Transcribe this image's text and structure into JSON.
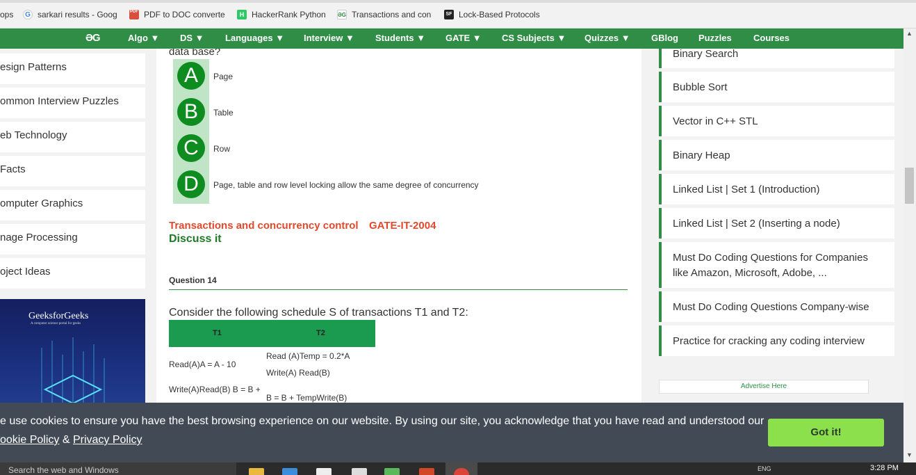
{
  "bookmarks": [
    {
      "label": "ops",
      "icon": "apps-icon",
      "color": ""
    },
    {
      "label": "sarkari results - Goog",
      "icon": "google-icon",
      "color": "#4285f4"
    },
    {
      "label": "PDF to DOC converte",
      "icon": "pdf-icon",
      "color": "#d94f3d"
    },
    {
      "label": "HackerRank Python",
      "icon": "hackerrank-icon",
      "color": "#2ec866"
    },
    {
      "label": "Transactions and con",
      "icon": "gfg-icon",
      "color": "#2f8d46"
    },
    {
      "label": "Lock-Based Protocols",
      "icon": "sf-icon",
      "color": "#222222"
    }
  ],
  "bookmark_icon_text": {
    "pdf": "PDF",
    "hackerrank": "H",
    "gfg": "ƏG",
    "sf": "SF"
  },
  "nav": {
    "logo": "ƏG",
    "items": [
      "Algo ▼",
      "DS ▼",
      "Languages ▼",
      "Interview ▼",
      "Students ▼",
      "GATE ▼",
      "CS Subjects ▼",
      "Quizzes ▼",
      "GBlog",
      "Puzzles",
      "Courses"
    ]
  },
  "sidebar_left": {
    "items": [
      "esign Patterns",
      "ommon Interview Puzzles",
      "eb Technology",
      "Facts",
      "omputer Graphics",
      "nage Processing",
      "oject Ideas"
    ],
    "ad": {
      "title": "GeeksforGeeks",
      "subtitle": "A computer science portal for geeks"
    }
  },
  "question": {
    "text_fragment": "data base?",
    "options": [
      {
        "letter": "A",
        "text": "Page"
      },
      {
        "letter": "B",
        "text": "Table"
      },
      {
        "letter": "C",
        "text": "Row"
      },
      {
        "letter": "D",
        "text": "Page, table and row level locking allow the same degree of concurrency"
      }
    ],
    "topic": "Transactions and concurrency control",
    "exam": "GATE-IT-2004",
    "discuss": "Discuss it"
  },
  "question14": {
    "label": "Question 14",
    "text": "Consider the following schedule S of transactions T1 and T2:",
    "headers": [
      "T1",
      "T2"
    ],
    "rows": [
      {
        "t1": "",
        "t2": "Read (A)Temp = 0.2*A"
      },
      {
        "t1": "Read(A)A = A - 10",
        "t2": ""
      },
      {
        "t1": "",
        "t2": "Write(A) Read(B)"
      },
      {
        "t1": "Write(A)Read(B) B = B +",
        "t2": ""
      },
      {
        "t1": "",
        "t2": "B = B + TempWrite(B)"
      }
    ]
  },
  "sidebar_right": {
    "items": [
      "Binary Search",
      "Bubble Sort",
      "Vector in C++ STL",
      "Binary Heap",
      "Linked List | Set 1 (Introduction)",
      "Linked List | Set 2 (Inserting a node)",
      "Must Do Coding Questions for Companies like Amazon, Microsoft, Adobe, ...",
      "Must Do Coding Questions Company-wise",
      "Practice for cracking any coding interview"
    ],
    "advertise": "Advertise Here"
  },
  "cookie": {
    "message": "e use cookies to ensure you have the best browsing experience on our website. By using our site, you acknowledge that you have read and understood our",
    "cookie_policy": "ookie Policy",
    "separator": "&",
    "privacy_policy": "Privacy Policy",
    "button": "Got it!"
  },
  "taskbar": {
    "search_placeholder": "Search the web and Windows",
    "system_tray": "ENG",
    "time": "3:28 PM"
  },
  "scrollbar": {
    "up_arrow": "▲",
    "down_arrow": "▼"
  }
}
